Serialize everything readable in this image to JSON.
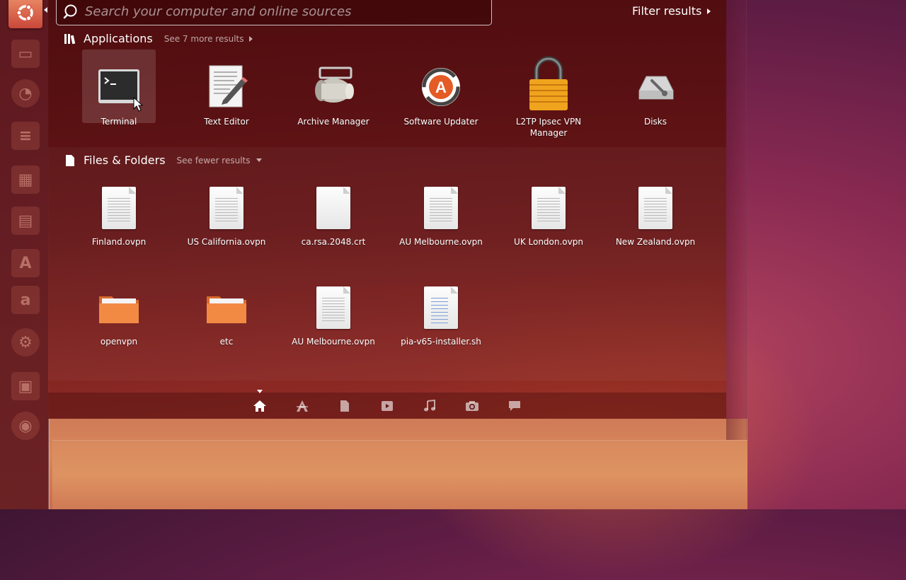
{
  "search": {
    "placeholder": "Search your computer and online sources",
    "value": ""
  },
  "filter_results": {
    "label": "Filter results"
  },
  "applications": {
    "title": "Applications",
    "see_more": "See 7 more results",
    "items": [
      {
        "label": "Terminal",
        "icon": "terminal-icon",
        "selected": true
      },
      {
        "label": "Text Editor",
        "icon": "text-editor-icon"
      },
      {
        "label": "Archive Manager",
        "icon": "archive-manager-icon"
      },
      {
        "label": "Software Updater",
        "icon": "software-updater-icon"
      },
      {
        "label": "L2TP Ipsec VPN Manager",
        "icon": "lock-icon"
      },
      {
        "label": "Disks",
        "icon": "disks-icon"
      }
    ]
  },
  "files_folders": {
    "title": "Files & Folders",
    "see_fewer": "See fewer results",
    "items": [
      {
        "label": "Finland.ovpn",
        "icon": "document-icon"
      },
      {
        "label": "US California.ovpn",
        "icon": "document-icon"
      },
      {
        "label": "ca.rsa.2048.crt",
        "icon": "blank-document-icon"
      },
      {
        "label": "AU Melbourne.ovpn",
        "icon": "document-icon"
      },
      {
        "label": "UK London.ovpn",
        "icon": "document-icon"
      },
      {
        "label": "New Zealand.ovpn",
        "icon": "document-icon"
      },
      {
        "label": "openvpn",
        "icon": "folder-icon"
      },
      {
        "label": "etc",
        "icon": "folder-icon"
      },
      {
        "label": "AU Melbourne.ovpn",
        "icon": "document-icon"
      },
      {
        "label": "pia-v65-installer.sh",
        "icon": "script-icon"
      }
    ]
  },
  "lenses": [
    {
      "icon": "home-lens-icon",
      "active": true
    },
    {
      "icon": "applications-lens-icon"
    },
    {
      "icon": "files-lens-icon"
    },
    {
      "icon": "video-lens-icon"
    },
    {
      "icon": "music-lens-icon"
    },
    {
      "icon": "photo-lens-icon"
    },
    {
      "icon": "social-lens-icon"
    }
  ],
  "launcher": {
    "items": [
      {
        "icon": "ubuntu-logo-icon"
      },
      {
        "icon": "files-launcher-icon"
      },
      {
        "icon": "firefox-launcher-icon"
      },
      {
        "icon": "writer-launcher-icon"
      },
      {
        "icon": "calc-launcher-icon"
      },
      {
        "icon": "impress-launcher-icon"
      },
      {
        "icon": "software-center-launcher-icon"
      },
      {
        "icon": "amazon-launcher-icon"
      },
      {
        "icon": "settings-launcher-icon"
      },
      {
        "icon": "workspace-launcher-icon"
      },
      {
        "icon": "dvd-launcher-icon"
      }
    ]
  },
  "colors": {
    "dash_bg": "#5a0e0c",
    "folder_orange": "#f07a3a",
    "accent": "#e95420"
  }
}
